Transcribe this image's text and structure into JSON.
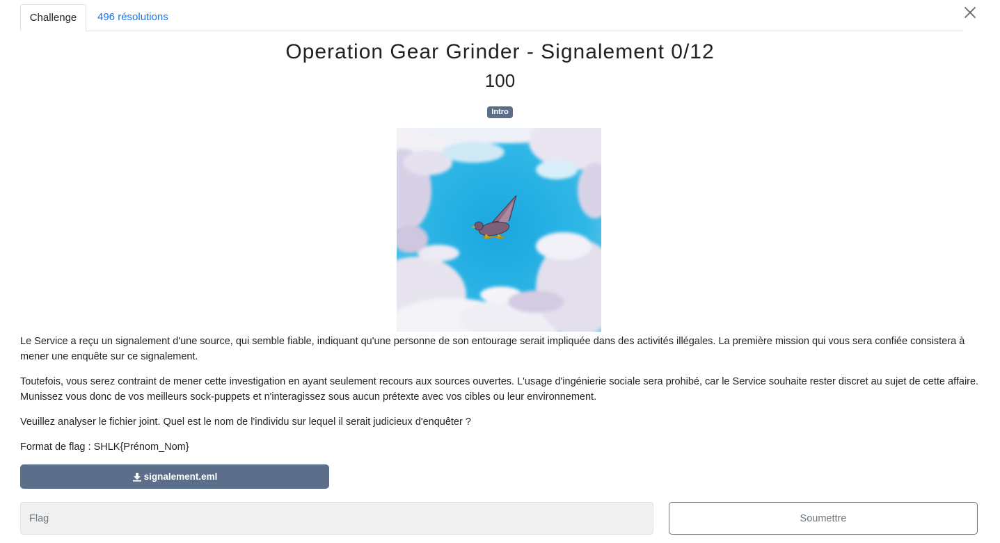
{
  "tabs": {
    "challenge": "Challenge",
    "solves": "496 résolutions"
  },
  "challenge": {
    "title": "Operation Gear Grinder - Signalement 0/12",
    "points": "100",
    "category": "Intro",
    "image_subject": "watercolor pigeon flying in blue sky with clouds",
    "paragraphs": [
      "Le Service a reçu un signalement d'une source, qui semble fiable, indiquant qu'une personne de son entourage serait impliquée dans des activités illégales. La première mission qui vous sera confiée consistera à mener une enquête sur ce signalement.",
      "Toutefois, vous serez contraint de mener cette investigation en ayant seulement recours aux sources ouvertes. L'usage d'ingénierie sociale sera prohibé, car le Service souhaite rester discret au sujet de cette affaire. Munissez vous donc de vos meilleurs sock-puppets et n'interagissez sous aucun prétexte avec vos cibles ou leur environnement.",
      "Veuillez analyser le fichier joint. Quel est le nom de l'individu sur lequel il serait judicieux d'enquêter ?",
      "Format de flag : SHLK{Prénom_Nom}"
    ],
    "attachment": "signalement.eml"
  },
  "form": {
    "flag_placeholder": "Flag",
    "flag_value": "",
    "submit_label": "Soumettre"
  },
  "colors": {
    "accent": "#5c6f8a",
    "link": "#1a73e8",
    "sky": "#2bb0e2"
  },
  "icons": {
    "close": "close-icon",
    "download": "download-icon"
  }
}
